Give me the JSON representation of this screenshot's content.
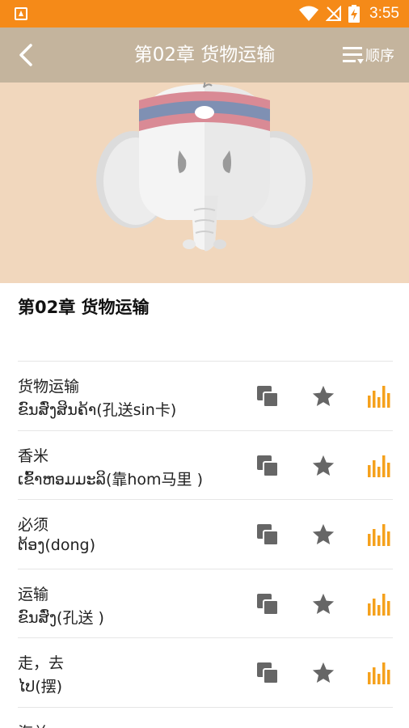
{
  "status_bar": {
    "time": "3:55",
    "icons": [
      "app-notification-icon",
      "wifi-icon",
      "no-signal-icon",
      "battery-charging-icon"
    ]
  },
  "app_bar": {
    "title": "第02章 货物运输",
    "back_icon": "chevron-left-icon",
    "order_label": "顺序",
    "order_icon": "sort-list-icon"
  },
  "hero": {
    "illustration": "elephant-mascot-icon",
    "background_color": "#f1d7bd"
  },
  "chapter_title": "第02章 货物运输",
  "colors": {
    "status_bar": "#f58a18",
    "app_bar": "#c4b49d",
    "accent_audio": "#f5a11c",
    "icon_gray": "#666666"
  },
  "vocab": [
    {
      "word": "货物运输",
      "translation": "ຂົນສົ່ງສິນຄ້າ(孔送sin卡)"
    },
    {
      "word": "香米",
      "translation": "ເຂົ້າຫອມມະລິ(靠hom马里 )"
    },
    {
      "word": "必须",
      "translation": "ຕ້ອງ(dong)"
    },
    {
      "word": "运输",
      "translation": "ຂົນສົ່ງ(孔送 )"
    },
    {
      "word": "走，去",
      "translation": "ໄປ(摆)"
    },
    {
      "word": "海关",
      "translation": ""
    }
  ],
  "row_actions": {
    "copy_icon": "copy-icon",
    "favorite_icon": "star-icon",
    "audio_icon": "audio-bars-icon"
  }
}
